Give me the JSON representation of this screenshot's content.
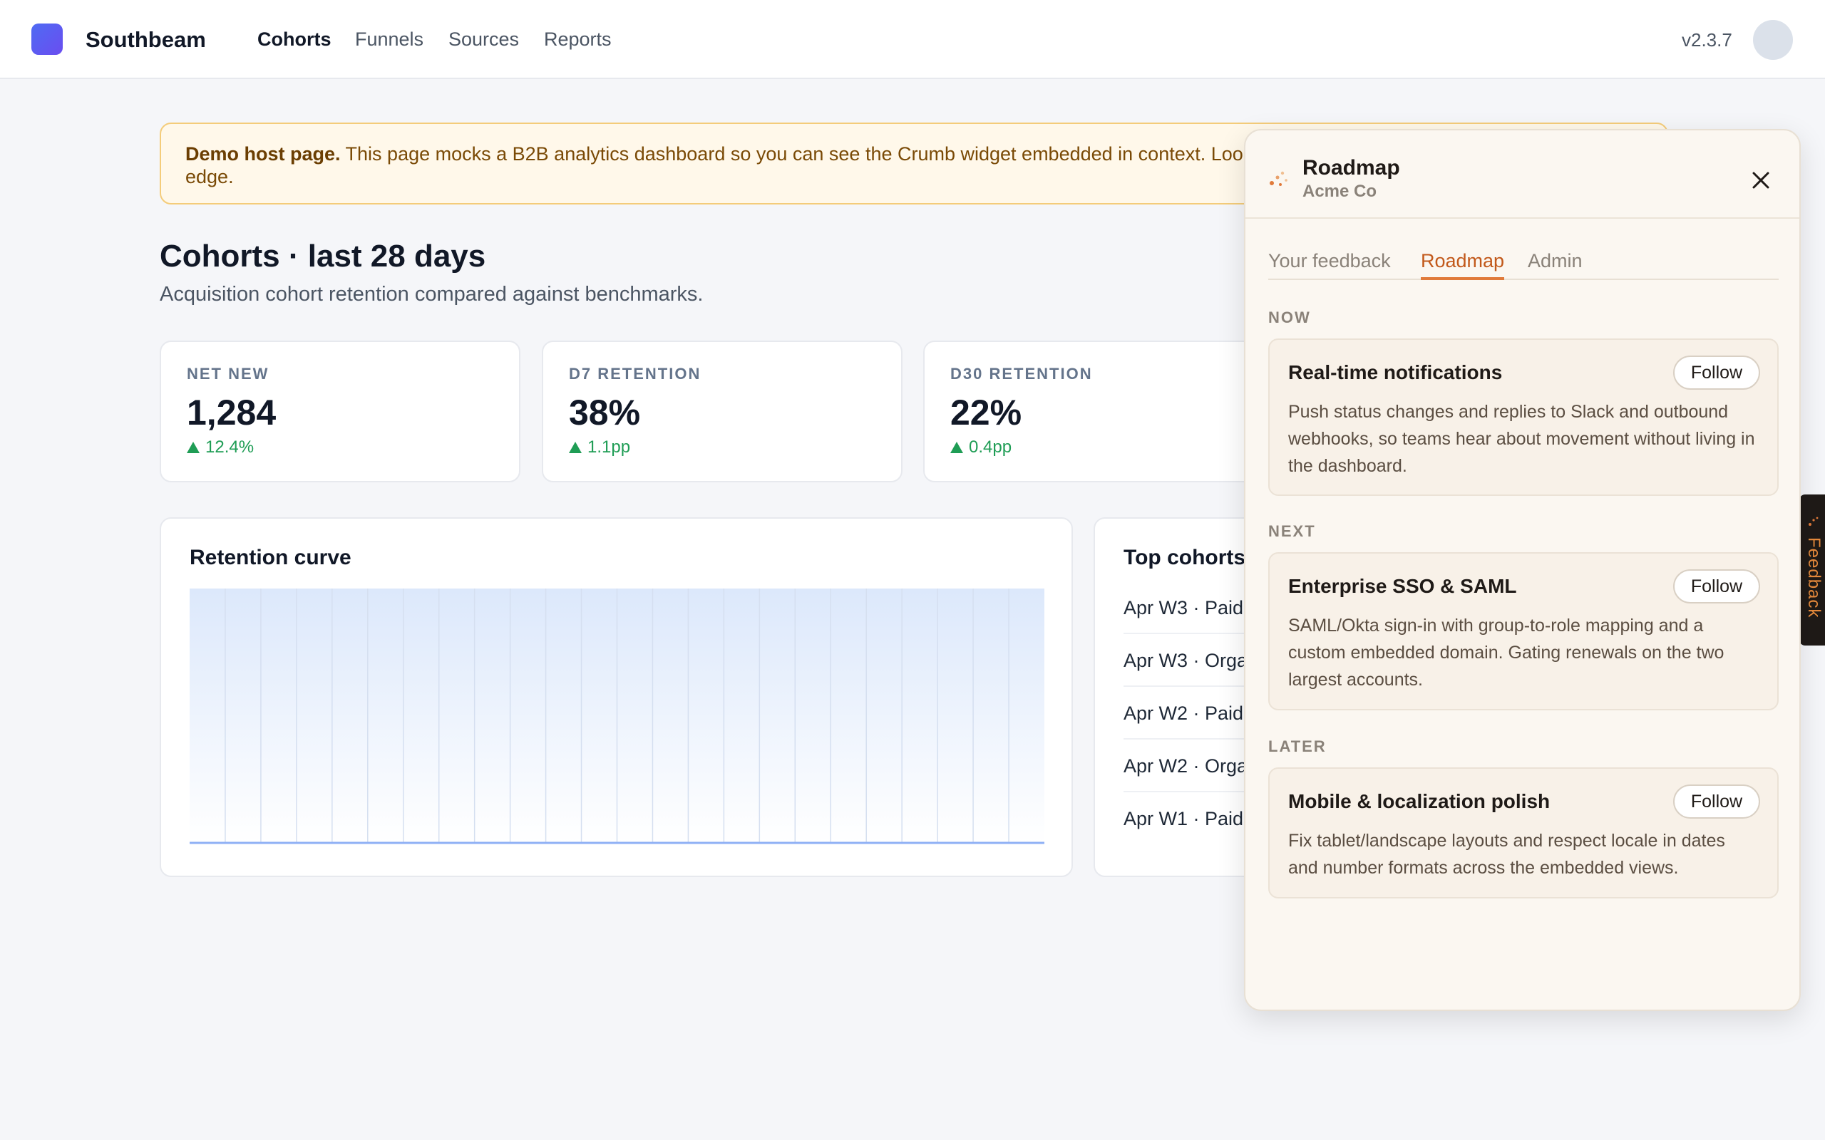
{
  "header": {
    "brand": "Southbeam",
    "nav": [
      {
        "label": "Cohorts",
        "active": true
      },
      {
        "label": "Funnels",
        "active": false
      },
      {
        "label": "Sources",
        "active": false
      },
      {
        "label": "Reports",
        "active": false
      }
    ],
    "version": "v2.3.7"
  },
  "banner": {
    "bold": "Demo host page.",
    "text": " This page mocks a B2B analytics dashboard so you can see the Crumb widget embedded in context. Loo",
    "text2": "edge."
  },
  "page": {
    "title": "Cohorts · last 28 days",
    "subtitle": "Acquisition cohort retention compared against benchmarks."
  },
  "stats": [
    {
      "label": "NET NEW",
      "value": "1,284",
      "delta": "12.4%"
    },
    {
      "label": "D7 RETENTION",
      "value": "38%",
      "delta": "1.1pp"
    },
    {
      "label": "D30 RETENTION",
      "value": "22%",
      "delta": "0.4pp"
    }
  ],
  "retention": {
    "title": "Retention curve"
  },
  "chart_data": {
    "type": "area",
    "title": "Retention curve",
    "xlabel": "",
    "ylabel": "",
    "grid": true,
    "colors": {
      "line": "#8fb0f5",
      "fill_top": "#dce8fb",
      "fill_bottom": "#ffffff",
      "grid": "#d5dff0"
    }
  },
  "cohorts": {
    "title": "Top cohorts",
    "rows": [
      "Apr W3 · Paid",
      "Apr W3 · Orga",
      "Apr W2 · Paid",
      "Apr W2 · Orga",
      "Apr W1 · Paid"
    ]
  },
  "side_tab": {
    "label": "Feedback"
  },
  "widget": {
    "title": "Roadmap",
    "org": "Acme Co",
    "tabs": [
      {
        "label": "Your feedback",
        "active": false
      },
      {
        "label": "Roadmap",
        "active": true
      },
      {
        "label": "Admin",
        "active": false
      }
    ],
    "sections": [
      {
        "label": "NOW",
        "item": {
          "title": "Real-time notifications",
          "follow": "Follow",
          "desc": "Push status changes and replies to Slack and outbound webhooks, so teams hear about movement without living in the dashboard."
        }
      },
      {
        "label": "NEXT",
        "item": {
          "title": "Enterprise SSO & SAML",
          "follow": "Follow",
          "desc": "SAML/Okta sign-in with group-to-role mapping and a custom embedded domain. Gating renewals on the two largest accounts."
        }
      },
      {
        "label": "LATER",
        "item": {
          "title": "Mobile & localization polish",
          "follow": "Follow",
          "desc": "Fix tablet/landscape layouts and respect locale in dates and number formats across the embedded views."
        }
      }
    ]
  },
  "colors": {
    "accent": "#e07a3a",
    "brand": "#5468f2",
    "positive": "#1f9d55",
    "banner_bg": "#fff8ea"
  }
}
